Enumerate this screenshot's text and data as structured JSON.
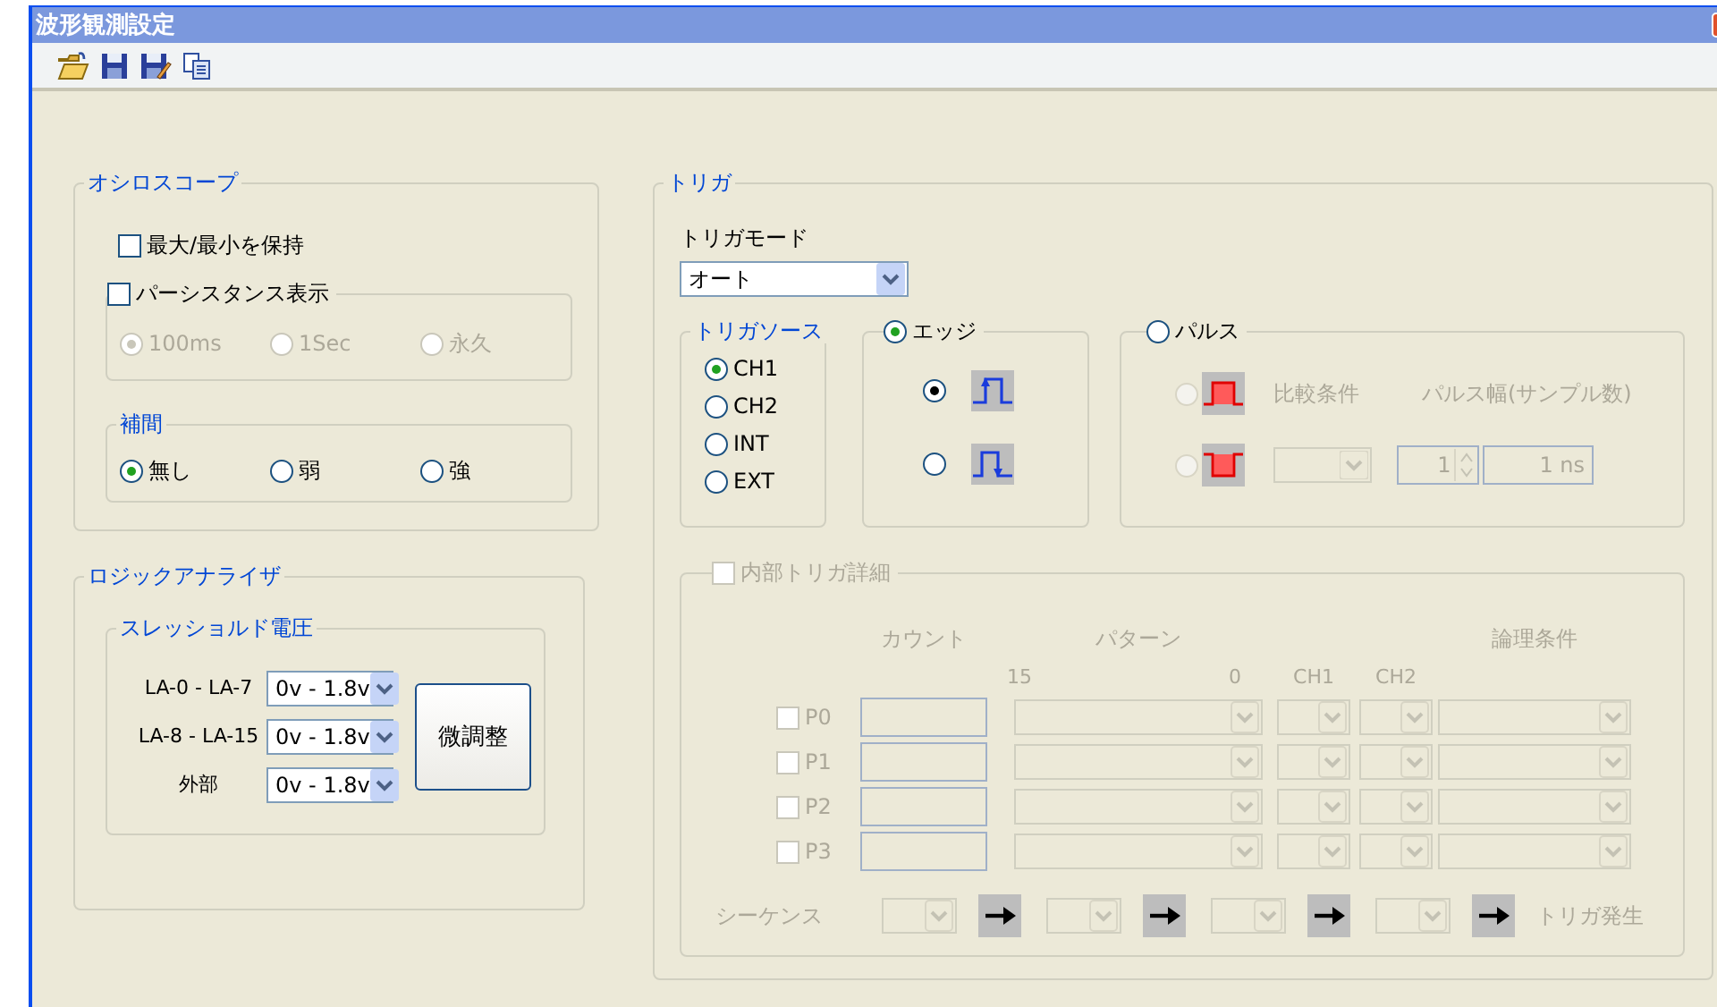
{
  "window": {
    "title": "波形観測設定"
  },
  "oscilloscope": {
    "title": "オシロスコープ",
    "hold": {
      "label": "最大/最小を保持",
      "checked": false
    },
    "persistence": {
      "label": "パーシスタンス表示",
      "checked": false,
      "disabled": true,
      "options": [
        {
          "label": "100ms",
          "selected": true
        },
        {
          "label": "1Sec",
          "selected": false
        },
        {
          "label": "永久",
          "selected": false
        }
      ]
    },
    "interpolation": {
      "title": "補間",
      "options": [
        {
          "label": "無し",
          "selected": true
        },
        {
          "label": "弱",
          "selected": false
        },
        {
          "label": "強",
          "selected": false
        }
      ]
    }
  },
  "logic_analyzer": {
    "title": "ロジックアナライザ",
    "threshold": {
      "title": "スレッショルド電圧",
      "rows": [
        {
          "label": "LA-0 - LA-7",
          "value": "0v - 1.8v"
        },
        {
          "label": "LA-8 - LA-15",
          "value": "0v - 1.8v"
        },
        {
          "label": "外部",
          "value": "0v - 1.8v"
        }
      ],
      "button": "微調整"
    }
  },
  "trigger": {
    "title": "トリガ",
    "mode": {
      "label": "トリガモード",
      "value": "オート"
    },
    "source": {
      "title": "トリガソース",
      "options": [
        {
          "label": "CH1",
          "selected": true
        },
        {
          "label": "CH2",
          "selected": false
        },
        {
          "label": "INT",
          "selected": false
        },
        {
          "label": "EXT",
          "selected": false
        }
      ]
    },
    "edge": {
      "label": "エッジ",
      "selected": true,
      "options": [
        {
          "kind": "rising",
          "selected": true
        },
        {
          "kind": "falling",
          "selected": false
        }
      ]
    },
    "pulse": {
      "label": "パルス",
      "selected": false,
      "disabled": true,
      "options": [
        {
          "kind": "positive",
          "selected": false
        },
        {
          "kind": "negative",
          "selected": false
        }
      ],
      "compare_label": "比較条件",
      "width_label": "パルス幅(サンプル数)",
      "width_value": "1",
      "time_value": "1 ns"
    },
    "internal": {
      "label": "内部トリガ詳細",
      "checked": false,
      "disabled": true,
      "headers": {
        "count": "カウント",
        "pattern": "パターン",
        "bit_high": "15",
        "bit_low": "0",
        "ch1": "CH1",
        "ch2": "CH2",
        "logic": "論理条件"
      },
      "rows": [
        {
          "label": "P0",
          "checked": false
        },
        {
          "label": "P1",
          "checked": false
        },
        {
          "label": "P2",
          "checked": false
        },
        {
          "label": "P3",
          "checked": false
        }
      ],
      "sequence_label": "シーケンス",
      "end_label": "トリガ発生"
    }
  }
}
